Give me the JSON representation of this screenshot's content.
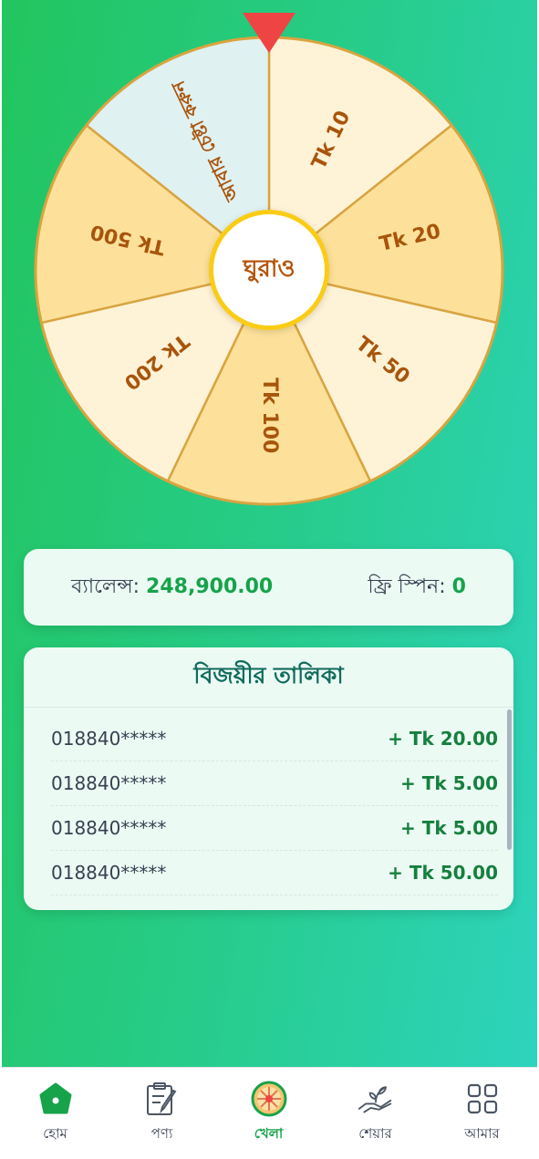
{
  "wheel": {
    "segments": [
      {
        "label": "Tk 10"
      },
      {
        "label": "Tk 20"
      },
      {
        "label": "Tk 50"
      },
      {
        "label": "Tk 100"
      },
      {
        "label": "Tk 200"
      },
      {
        "label": "Tk 500"
      },
      {
        "label": "আবার চেষ্টা করুন"
      }
    ],
    "spin_label": "ঘুরাও"
  },
  "balance": {
    "label": "ব্যালেন্স:",
    "value": "248,900.00",
    "free_spin_label": "ফ্রি স্পিন:",
    "free_spin_value": "0"
  },
  "winners": {
    "title": "বিজয়ীর তালিকা",
    "rows": [
      {
        "phone": "018840*****",
        "amount": "+ Tk 20.00"
      },
      {
        "phone": "018840*****",
        "amount": "+ Tk 5.00"
      },
      {
        "phone": "018840*****",
        "amount": "+ Tk 5.00"
      },
      {
        "phone": "018840*****",
        "amount": "+ Tk 50.00"
      }
    ]
  },
  "nav": {
    "items": [
      {
        "label": "হোম",
        "icon": "home-icon"
      },
      {
        "label": "পণ্য",
        "icon": "clipboard-icon"
      },
      {
        "label": "খেলা",
        "icon": "wheel-icon"
      },
      {
        "label": "শেয়ার",
        "icon": "hand-plant-icon"
      },
      {
        "label": "আমার",
        "icon": "grid-icon"
      }
    ]
  },
  "colors": {
    "accent": "#16a34a",
    "wheel_light": "#fef3d6",
    "wheel_mid": "#fde19a",
    "wheel_retry": "#e0f1f1",
    "wheel_text": "#a8550c",
    "pointer": "#ef4444"
  }
}
